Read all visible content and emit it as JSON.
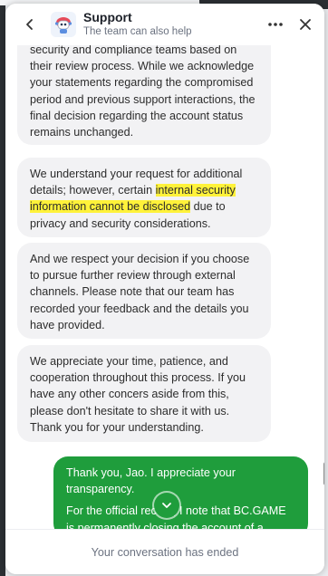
{
  "header": {
    "title": "Support",
    "subtitle": "The team can also help"
  },
  "messages": {
    "agent": [
      {
        "text": "security and compliance teams based on their review process. While we acknowledge your statements regarding the compromised period and previous support interactions, the final decision regarding the account status remains unchanged."
      },
      {
        "before": "We understand your request for additional details; however, certain ",
        "highlight": "internal security information cannot be disclosed",
        "after": " due to privacy and security considerations."
      },
      {
        "text": "And we respect your decision if you choose to pursue further review through external channels. Please note that our team has recorded your feedback and the details you have provided."
      },
      {
        "text": "We appreciate your time, patience, and cooperation throughout this process. If you have any other concers aside from this, please don't hesitate to share it with us. Thank you for your understanding."
      }
    ],
    "user": {
      "line1": "Thank you, Jao. I appreciate your transparency.",
      "line2": "For the official record, I note that BC.GAME is permanently closing the account of a"
    }
  },
  "footer": {
    "status": "Your conversation has ended"
  },
  "colors": {
    "accent": "#1f9d3c",
    "bubble": "#f2f2f4",
    "highlight": "#fff23a"
  },
  "icons": {
    "back": "chevron-left-icon",
    "avatar": "support-bot-icon",
    "more": "more-horizontal-icon",
    "close": "close-icon",
    "scroll": "chevron-down-icon"
  }
}
